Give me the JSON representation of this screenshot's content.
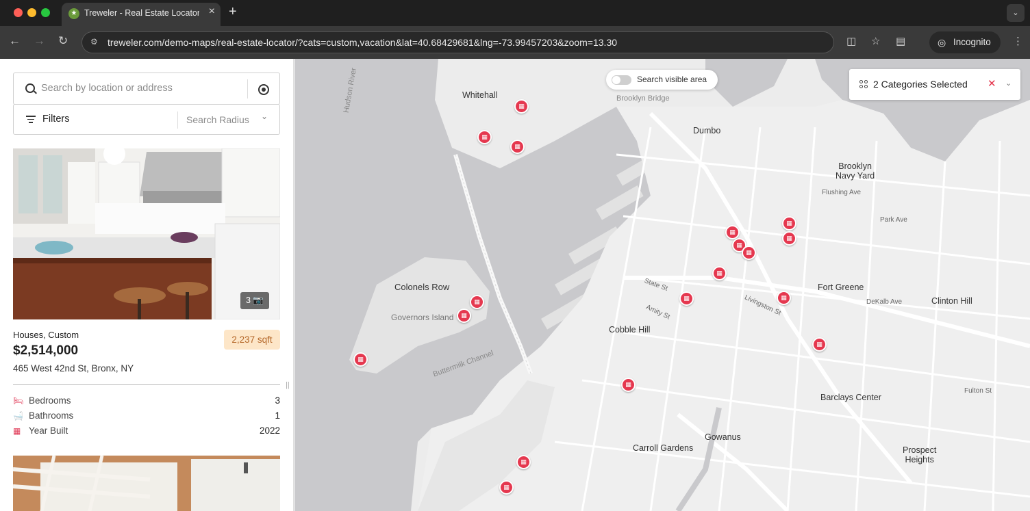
{
  "browser": {
    "tab_title": "Treweler - Real Estate Locator",
    "url": "treweler.com/demo-maps/real-estate-locator/?cats=custom,vacation&lat=40.68429681&lng=-73.99457203&zoom=13.30",
    "incognito_label": "Incognito"
  },
  "sidebar": {
    "search_placeholder": "Search by location or address",
    "filters_label": "Filters",
    "radius_placeholder": "Search Radius",
    "listing": {
      "type": "Houses, Custom",
      "price": "$2,514,000",
      "address": "465 West 42nd St, Bronx, NY",
      "sqft": "2,237 sqft",
      "photo_count": "3",
      "specs": [
        {
          "label": "Bedrooms",
          "value": "3"
        },
        {
          "label": "Bathrooms",
          "value": "1"
        },
        {
          "label": "Year Built",
          "value": "2022"
        }
      ]
    }
  },
  "map": {
    "toggle_label": "Search visible area",
    "categories_label": "2 Categories Selected",
    "labels": {
      "whitehall": "Whitehall",
      "brooklyn_bridge": "Brooklyn Bridge",
      "dumbo": "Dumbo",
      "navy_yard": "Brooklyn\nNavy Yard",
      "colonels_row": "Colonels Row",
      "governors_island": "Governors Island",
      "fort_greene": "Fort Greene",
      "clinton_hill": "Clinton Hill",
      "cobble_hill": "Cobble Hill",
      "barclays": "Barclays Center",
      "gowanus": "Gowanus",
      "carroll_gardens": "Carroll Gardens",
      "prospect_heights": "Prospect\nHeights",
      "hudson_river": "Hudson River",
      "buttermilk": "Buttermilk Channel",
      "flushing": "Flushing Ave",
      "park_ave": "Park Ave",
      "dekalb": "DeKalb Ave",
      "fulton": "Fulton St",
      "state_st": "State St",
      "livingston": "Livingston St",
      "atlantic": "Amity St"
    }
  }
}
